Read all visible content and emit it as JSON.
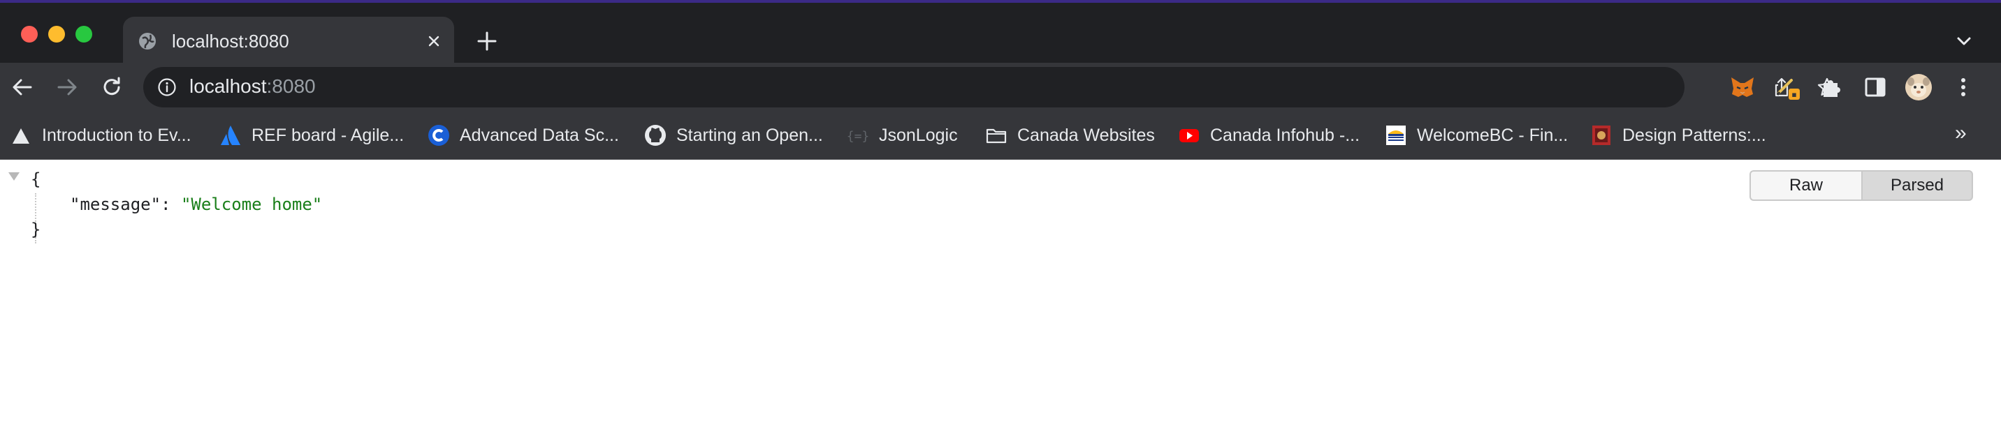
{
  "browser": {
    "tab": {
      "title": "localhost:8080"
    },
    "address": {
      "host": "localhost",
      "port": ":8080"
    }
  },
  "bookmarks": [
    {
      "label": "Introduction to Ev...",
      "icon": "leaf-icon"
    },
    {
      "label": "REF board - Agile...",
      "icon": "atlassian-icon"
    },
    {
      "label": "Advanced Data Sc...",
      "icon": "c-logo-icon"
    },
    {
      "label": "Starting an Open...",
      "icon": "github-icon"
    },
    {
      "label": "JsonLogic",
      "icon": "braces-icon"
    },
    {
      "label": "Canada Websites",
      "icon": "folder-icon"
    },
    {
      "label": "Canada Infohub -...",
      "icon": "youtube-icon"
    },
    {
      "label": "WelcomeBC - Fin...",
      "icon": "bc-flag-icon"
    },
    {
      "label": "Design Patterns:...",
      "icon": "book-icon"
    }
  ],
  "viewer": {
    "raw_label": "Raw",
    "parsed_label": "Parsed",
    "open_brace": "{",
    "close_brace": "}",
    "key": "\"message\"",
    "colon": ": ",
    "value": "\"Welcome home\""
  },
  "colors": {
    "tabstrip": "#1f2023",
    "toolbar": "#35363a",
    "omnibox": "#202124",
    "json_string": "#1a7f1a"
  }
}
